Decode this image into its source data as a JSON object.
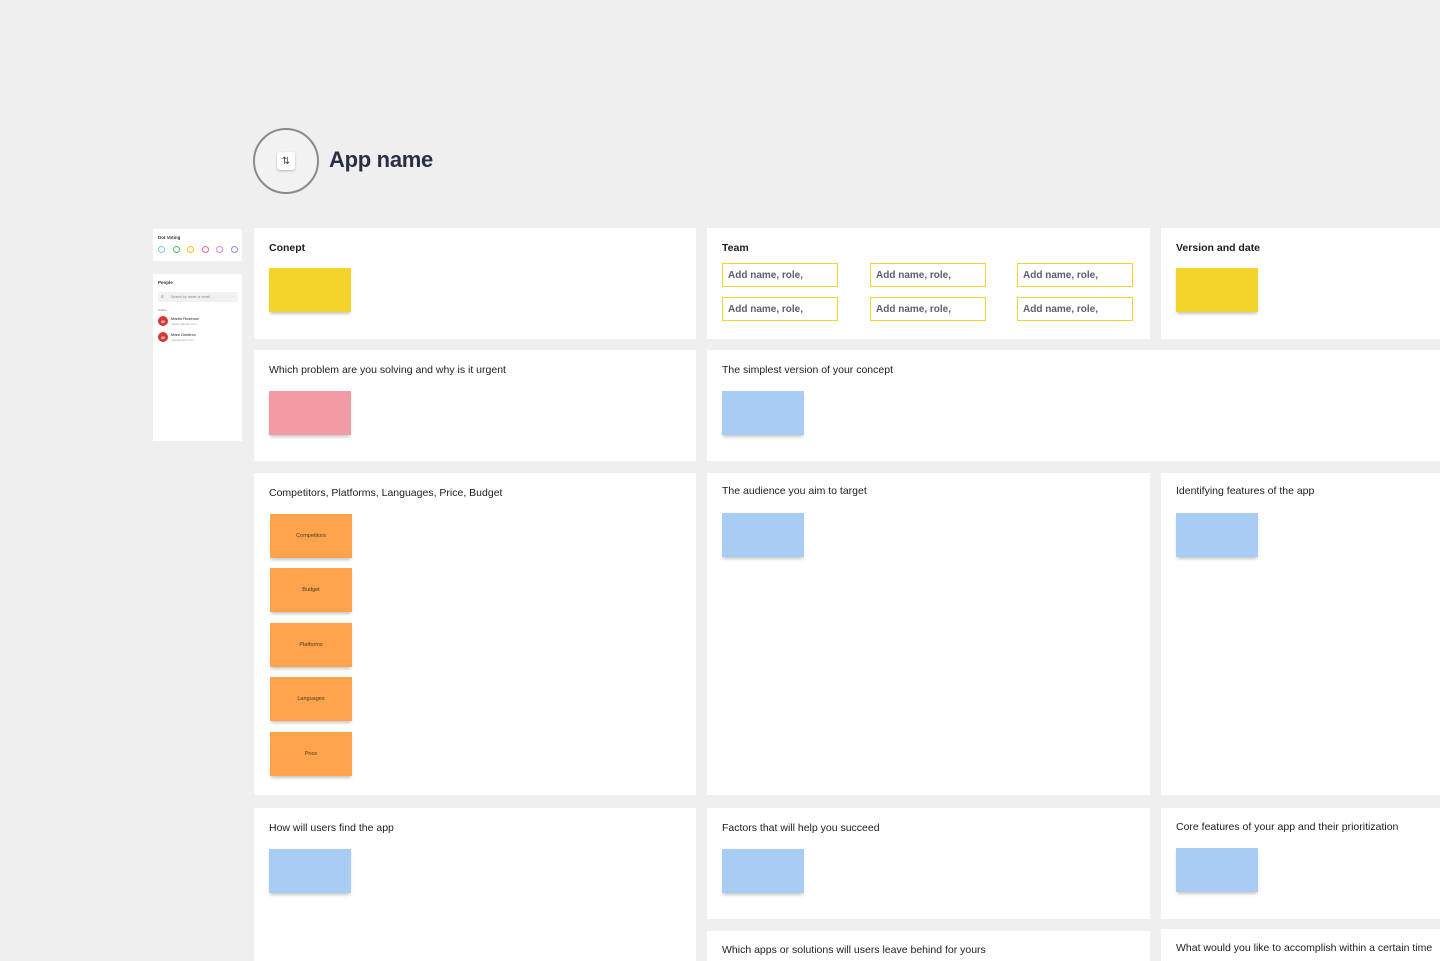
{
  "header": {
    "app_name": "App name",
    "logo_glyph": "⇅"
  },
  "sidebar": {
    "dot_voting": {
      "title": "Dot Voting",
      "dots": [
        "#7ec8e3",
        "#41c463",
        "#f1c40f",
        "#ec5f9b",
        "#d88be0",
        "#8f8ff0"
      ]
    },
    "people": {
      "title": "People",
      "search_placeholder": "Search by name or email",
      "section_label": "Online",
      "members": [
        {
          "initial": "M",
          "name": "Martin Rusenov",
          "email": "martin.r@miro.com"
        },
        {
          "initial": "M",
          "name": "Mare Dimitrov",
          "email": "mare@miro.com"
        }
      ]
    }
  },
  "panels": {
    "concept": {
      "title": "Conept"
    },
    "team": {
      "title": "Team",
      "slots": [
        "Add name, role,",
        "Add name, role,",
        "Add name, role,",
        "Add name, role,",
        "Add name, role,",
        "Add name, role,"
      ]
    },
    "version": {
      "title": "Version and date"
    },
    "problem": {
      "title": "Which problem are you solving and why is it urgent"
    },
    "simplest": {
      "title": "The simplest version of your concept"
    },
    "competitors": {
      "title": "Competitors, Platforms, Languages, Price, Budget",
      "stickies": [
        "Competitors",
        "Budget",
        "Platforms",
        "Languages",
        "Price"
      ]
    },
    "audience": {
      "title": "The audience you aim to target"
    },
    "identifying": {
      "title": "Identifying features of the app"
    },
    "find_app": {
      "title": "How will users find the app"
    },
    "factors": {
      "title": "Factors that will help you succeed"
    },
    "core": {
      "title": "Core features of your app and their prioritization"
    },
    "leave_behind": {
      "title": "Which apps or solutions will users leave behind for yours"
    },
    "accomplish": {
      "title": "What would you like to accomplish within a certain time"
    }
  }
}
